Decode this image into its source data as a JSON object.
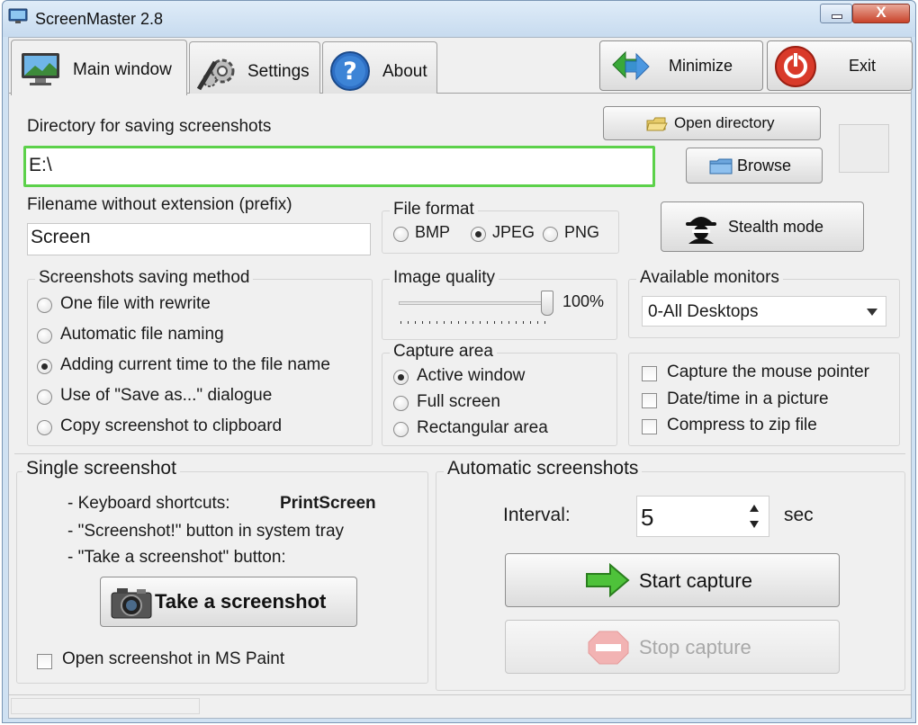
{
  "window": {
    "title": "ScreenMaster 2.8",
    "close_glyph": "X",
    "accent_color": "#5cd14a"
  },
  "tabs": [
    {
      "label": "Main window",
      "icon": "monitor-icon"
    },
    {
      "label": "Settings",
      "icon": "gears-icon"
    },
    {
      "label": "About",
      "icon": "help-icon"
    }
  ],
  "header_buttons": {
    "minimize": "Minimize",
    "exit": "Exit"
  },
  "directory": {
    "label": "Directory for saving screenshots",
    "value": "E:\\",
    "open_button": "Open directory",
    "browse_button": "Browse"
  },
  "filename": {
    "label": "Filename without extension (prefix)",
    "value": "Screen"
  },
  "file_format": {
    "legend": "File format",
    "options": [
      "BMP",
      "JPEG",
      "PNG"
    ],
    "selected": "JPEG"
  },
  "stealth_button": "Stealth mode",
  "saving_method": {
    "legend": "Screenshots saving method",
    "options": [
      "One file with rewrite",
      "Automatic file naming",
      "Adding current time to the file name",
      "Use of \"Save as...\" dialogue",
      "Copy screenshot to clipboard"
    ],
    "selected_index": 2
  },
  "image_quality": {
    "legend": "Image quality",
    "value_text": "100%",
    "value_fraction": 1.0
  },
  "monitors": {
    "legend": "Available monitors",
    "selected": "0-All Desktops"
  },
  "capture_area": {
    "legend": "Capture area",
    "options": [
      "Active window",
      "Full screen",
      "Rectangular area"
    ],
    "selected_index": 0
  },
  "options": {
    "items": [
      "Capture the mouse pointer",
      "Date/time in a picture",
      "Compress to zip file"
    ]
  },
  "single": {
    "legend": "Single screenshot",
    "shortcut_label": "- Keyboard shortcuts:",
    "shortcut_value": "PrintScreen",
    "tray_text": "- \"Screenshot!\" button in system tray",
    "button_text": "- \"Take a screenshot\" button:",
    "take_button": "Take a screenshot",
    "paint_checkbox": "Open screenshot in MS Paint"
  },
  "automatic": {
    "legend": "Automatic screenshots",
    "interval_label": "Interval:",
    "interval_value": "5",
    "unit": "sec",
    "start_button": "Start capture",
    "stop_button": "Stop capture"
  }
}
